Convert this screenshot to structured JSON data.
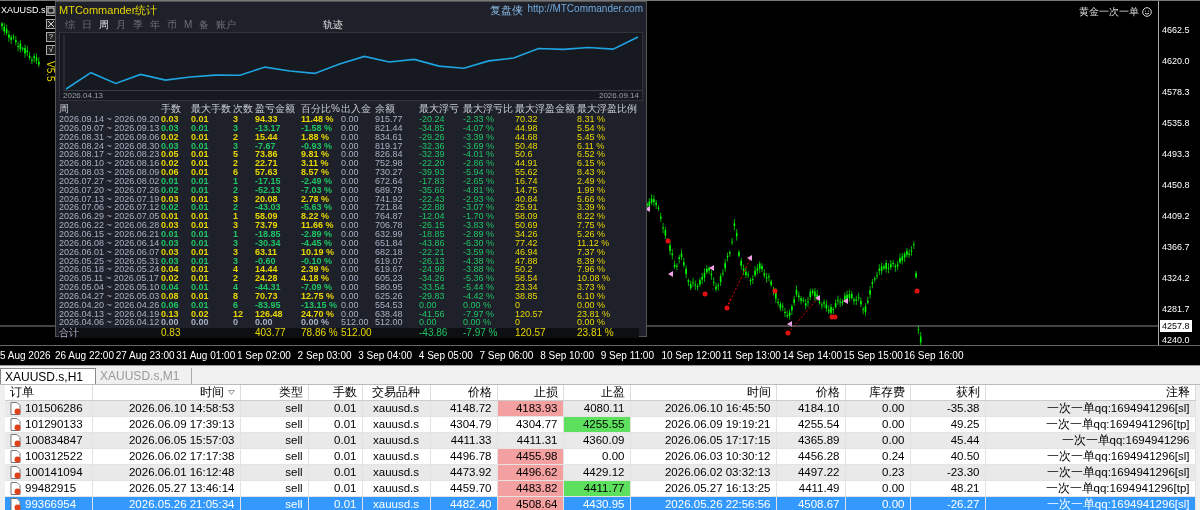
{
  "chart": {
    "symbol": "XAUUSD.s",
    "side_buttons": [
      {
        "kind": "window"
      },
      {
        "kind": "close"
      },
      {
        "kind": "text",
        "label": "?"
      },
      {
        "kind": "text",
        "label": "√"
      }
    ],
    "version": "V5.5",
    "corner_label": "黄金一次一单",
    "price_axis": [
      "4662.5",
      "4620.0",
      "4578.3",
      "4535.8",
      "4493.3",
      "4450.8",
      "4409.2",
      "4366.7",
      "4324.2",
      "4281.7",
      "4240.0"
    ],
    "current_price": "4257.8",
    "time_axis": [
      "5 Aug 2026",
      "26 Aug 22:00",
      "27 Aug 23:00",
      "31 Aug 01:00",
      "1 Sep 02:00",
      "2 Sep 03:00",
      "3 Sep 04:00",
      "4 Sep 05:00",
      "7 Sep 06:00",
      "8 Sep 10:00",
      "9 Sep 11:00",
      "10 Sep 12:00",
      "11 Sep 13:00",
      "14 Sep 14:00",
      "15 Sep 15:00",
      "16 Sep 16:00"
    ]
  },
  "stats_panel": {
    "title": "MTCommander统计",
    "brand": "复盘侠",
    "link": "http://MTCommander.com",
    "tabs": [
      {
        "label": "综",
        "selected": false
      },
      {
        "label": "日",
        "selected": false
      },
      {
        "label": "周",
        "selected": true
      },
      {
        "label": "月",
        "selected": false
      },
      {
        "label": "季",
        "selected": false
      },
      {
        "label": "年",
        "selected": false
      },
      {
        "label": "币",
        "selected": false
      },
      {
        "label": "M",
        "selected": false
      },
      {
        "label": "备",
        "selected": false
      },
      {
        "label": "账户",
        "selected": false
      }
    ],
    "trace_label": "轨迹",
    "curve_start": "2026.04.13",
    "curve_end": "2026.09.14",
    "columns": [
      "周",
      "手数",
      "最大手数",
      "次数",
      "盈亏金额",
      "百分比%",
      "出入金",
      "余额",
      "最大浮亏",
      "最大浮亏比",
      "最大浮盈金额",
      "最大浮盈比例"
    ],
    "rows": [
      {
        "week": "2026.09.14 ~ 2026.09.20",
        "color": "#e8d800",
        "values": [
          "0.03",
          "0.01",
          "3",
          "94.33",
          "11.48 %",
          "0.00",
          "915.77",
          "-20.24",
          "-2.33 %",
          "70.32",
          "8.31 %"
        ]
      },
      {
        "week": "2026.09.07 ~ 2026.09.13",
        "color": "#1ec466",
        "values": [
          "0.03",
          "0.01",
          "3",
          "-13.17",
          "-1.58 %",
          "0.00",
          "821.44",
          "-34.85",
          "-4.07 %",
          "44.98",
          "5.54 %"
        ]
      },
      {
        "week": "2026.08.31 ~ 2026.09.06",
        "color": "#e8d800",
        "values": [
          "0.02",
          "0.01",
          "2",
          "15.44",
          "1.88 %",
          "0.00",
          "834.61",
          "-29.26",
          "-3.39 %",
          "44.68",
          "5.45 %"
        ]
      },
      {
        "week": "2026.08.24 ~ 2026.08.30",
        "color": "#1ec466",
        "values": [
          "0.03",
          "0.01",
          "3",
          "-7.67",
          "-0.93 %",
          "0.00",
          "819.17",
          "-32.36",
          "-3.69 %",
          "50.48",
          "6.11 %"
        ]
      },
      {
        "week": "2026.08.17 ~ 2026.08.23",
        "color": "#e8d800",
        "values": [
          "0.05",
          "0.01",
          "5",
          "73.86",
          "9.81 %",
          "0.00",
          "826.84",
          "-32.39",
          "-4.01 %",
          "50.6",
          "6.52 %"
        ]
      },
      {
        "week": "2026.08.10 ~ 2026.08.16",
        "color": "#e8d800",
        "values": [
          "0.02",
          "0.01",
          "2",
          "22.71",
          "3.11 %",
          "0.00",
          "752.98",
          "-22.20",
          "-2.86 %",
          "44.91",
          "6.15 %"
        ]
      },
      {
        "week": "2026.08.03 ~ 2026.08.09",
        "color": "#e8d800",
        "values": [
          "0.06",
          "0.01",
          "6",
          "57.63",
          "8.57 %",
          "0.00",
          "730.27",
          "-39.93",
          "-5.94 %",
          "55.62",
          "8.43 %"
        ]
      },
      {
        "week": "2026.07.27 ~ 2026.08.02",
        "color": "#1ec466",
        "values": [
          "0.01",
          "0.01",
          "1",
          "-17.15",
          "-2.49 %",
          "0.00",
          "672.64",
          "-17.83",
          "-2.65 %",
          "16.74",
          "2.49 %"
        ]
      },
      {
        "week": "2026.07.20 ~ 2026.07.26",
        "color": "#1ec466",
        "values": [
          "0.02",
          "0.01",
          "2",
          "-52.13",
          "-7.03 %",
          "0.00",
          "689.79",
          "-35.66",
          "-4.81 %",
          "14.75",
          "1.99 %"
        ]
      },
      {
        "week": "2026.07.13 ~ 2026.07.19",
        "color": "#e8d800",
        "values": [
          "0.03",
          "0.01",
          "3",
          "20.08",
          "2.78 %",
          "0.00",
          "741.92",
          "-22.43",
          "-2.93 %",
          "40.84",
          "5.66 %"
        ]
      },
      {
        "week": "2026.07.06 ~ 2026.07.12",
        "color": "#1ec466",
        "values": [
          "0.02",
          "0.01",
          "2",
          "-43.03",
          "-5.63 %",
          "0.00",
          "721.84",
          "-22.88",
          "-3.07 %",
          "25.91",
          "3.39 %"
        ]
      },
      {
        "week": "2026.06.29 ~ 2026.07.05",
        "color": "#e8d800",
        "values": [
          "0.01",
          "0.01",
          "1",
          "58.09",
          "8.22 %",
          "0.00",
          "764.87",
          "-12.04",
          "-1.70 %",
          "58.09",
          "8.22 %"
        ]
      },
      {
        "week": "2026.06.22 ~ 2026.06.28",
        "color": "#e8d800",
        "values": [
          "0.03",
          "0.01",
          "3",
          "73.79",
          "11.66 %",
          "0.00",
          "706.78",
          "-26.15",
          "-3.83 %",
          "50.69",
          "7.75 %"
        ]
      },
      {
        "week": "2026.06.15 ~ 2026.06.21",
        "color": "#1ec466",
        "values": [
          "0.01",
          "0.01",
          "1",
          "-18.85",
          "-2.89 %",
          "0.00",
          "632.99",
          "-18.85",
          "-2.89 %",
          "34.26",
          "5.26 %"
        ]
      },
      {
        "week": "2026.06.08 ~ 2026.06.14",
        "color": "#1ec466",
        "values": [
          "0.03",
          "0.01",
          "3",
          "-30.34",
          "-4.45 %",
          "0.00",
          "651.84",
          "-43.86",
          "-6.30 %",
          "77.42",
          "11.12 %"
        ]
      },
      {
        "week": "2026.06.01 ~ 2026.06.07",
        "color": "#e8d800",
        "values": [
          "0.03",
          "0.01",
          "3",
          "63.11",
          "10.19 %",
          "0.00",
          "682.18",
          "-22.21",
          "-3.59 %",
          "46.94",
          "7.37 %"
        ]
      },
      {
        "week": "2026.05.25 ~ 2026.05.31",
        "color": "#1ec466",
        "values": [
          "0.03",
          "0.01",
          "3",
          "-0.60",
          "-0.10 %",
          "0.00",
          "619.07",
          "-26.13",
          "-4.38 %",
          "47.88",
          "8.39 %"
        ]
      },
      {
        "week": "2026.05.18 ~ 2026.05.24",
        "color": "#e8d800",
        "values": [
          "0.04",
          "0.01",
          "4",
          "14.44",
          "2.39 %",
          "0.00",
          "619.67",
          "-24.98",
          "-3.88 %",
          "50.2",
          "7.96 %"
        ]
      },
      {
        "week": "2026.05.11 ~ 2026.05.17",
        "color": "#e8d800",
        "values": [
          "0.02",
          "0.01",
          "2",
          "24.28",
          "4.18 %",
          "0.00",
          "605.23",
          "-34.26",
          "-5.36 %",
          "58.54",
          "10.08 %"
        ]
      },
      {
        "week": "2026.05.04 ~ 2026.05.10",
        "color": "#1ec466",
        "values": [
          "0.04",
          "0.01",
          "4",
          "-44.31",
          "-7.09 %",
          "0.00",
          "580.95",
          "-33.54",
          "-5.44 %",
          "23.34",
          "3.73 %"
        ]
      },
      {
        "week": "2026.04.27 ~ 2026.05.03",
        "color": "#e8d800",
        "values": [
          "0.08",
          "0.01",
          "8",
          "70.73",
          "12.75 %",
          "0.00",
          "625.26",
          "-29.83",
          "-4.42 %",
          "38.85",
          "6.10 %"
        ]
      },
      {
        "week": "2026.04.20 ~ 2026.04.26",
        "color": "#1ec466",
        "values": [
          "0.06",
          "0.01",
          "6",
          "-83.95",
          "-13.15 %",
          "0.00",
          "554.53",
          "0.00",
          "0.00 %",
          "0",
          "0.00 %"
        ]
      },
      {
        "week": "2026.04.13 ~ 2026.04.19",
        "color": "#e8d800",
        "values": [
          "0.13",
          "0.02",
          "12",
          "126.48",
          "24.70 %",
          "0.00",
          "638.48",
          "-41.56",
          "-7.97 %",
          "120.57",
          "23.81 %"
        ]
      },
      {
        "week": "2026.04.06 ~ 2026.04.12",
        "color": "#a8b0c4",
        "values": [
          "0.00",
          "0.00",
          "0",
          "0.00",
          "0.00 %",
          "512.00",
          "512.00",
          "0.00",
          "0.00 %",
          "0",
          "0.00 %"
        ]
      }
    ],
    "total": {
      "label": "合计",
      "lots": "0.83",
      "pnl": "403.77",
      "percent": "78.86 %",
      "deposit": "512.00",
      "max_float_loss": "-43.86",
      "max_float_loss_pct": "-7.97 %",
      "max_float_profit": "120.57",
      "max_float_profit_pct": "23.81 %"
    }
  },
  "chart_tabs": [
    {
      "label": "XAUUSD.s,H1",
      "selected": true
    },
    {
      "label": "XAUUSD.s,M1",
      "selected": false
    }
  ],
  "orders": {
    "columns": [
      {
        "label": "订单",
        "sorted": false
      },
      {
        "label": "时间",
        "sorted": true
      },
      {
        "label": "类型",
        "sorted": false
      },
      {
        "label": "手数",
        "sorted": false
      },
      {
        "label": "交易品种",
        "sorted": false
      },
      {
        "label": "价格",
        "sorted": false
      },
      {
        "label": "止损",
        "sorted": false
      },
      {
        "label": "止盈",
        "sorted": false
      },
      {
        "label": "时间",
        "sorted": false
      },
      {
        "label": "价格",
        "sorted": false
      },
      {
        "label": "库存费",
        "sorted": false
      },
      {
        "label": "获利",
        "sorted": false
      },
      {
        "label": "注释",
        "sorted": false
      }
    ],
    "rows": [
      {
        "cells": [
          "101506286",
          "2026.06.10 14:58:53",
          "sell",
          "0.01",
          "xauusd.s",
          "4148.72",
          "4183.93",
          "4080.11",
          "2026.06.10 16:45:50",
          "4184.10",
          "0.00",
          "-35.38",
          "一次一单qq:1694941296[sl]"
        ],
        "sl_highlight": true,
        "tp_highlight": false,
        "selected": false
      },
      {
        "cells": [
          "101290133",
          "2026.06.09 17:39:13",
          "sell",
          "0.01",
          "xauusd.s",
          "4304.79",
          "4304.77",
          "4255.55",
          "2026.06.09 19:19:21",
          "4255.54",
          "0.00",
          "49.25",
          "一次一单qq:1694941296[tp]"
        ],
        "sl_highlight": false,
        "tp_highlight": true,
        "selected": false
      },
      {
        "cells": [
          "100834847",
          "2026.06.05 15:57:03",
          "sell",
          "0.01",
          "xauusd.s",
          "4411.33",
          "4411.31",
          "4360.09",
          "2026.06.05 17:17:15",
          "4365.89",
          "0.00",
          "45.44",
          "一次一单qq:1694941296"
        ],
        "sl_highlight": false,
        "tp_highlight": false,
        "selected": false
      },
      {
        "cells": [
          "100312522",
          "2026.06.02 17:17:38",
          "sell",
          "0.01",
          "xauusd.s",
          "4496.78",
          "4455.98",
          "0.00",
          "2026.06.03 10:30:12",
          "4456.28",
          "0.24",
          "40.50",
          "一次一单qq:1694941296[sl]"
        ],
        "sl_highlight": true,
        "tp_highlight": false,
        "selected": false
      },
      {
        "cells": [
          "100141094",
          "2026.06.01 16:12:48",
          "sell",
          "0.01",
          "xauusd.s",
          "4473.92",
          "4496.62",
          "4429.12",
          "2026.06.02 03:32:13",
          "4497.22",
          "0.23",
          "-23.30",
          "一次一单qq:1694941296[sl]"
        ],
        "sl_highlight": true,
        "tp_highlight": false,
        "selected": false
      },
      {
        "cells": [
          "99482915",
          "2026.05.27 13:46:14",
          "sell",
          "0.01",
          "xauusd.s",
          "4459.70",
          "4483.82",
          "4411.77",
          "2026.05.27 16:13:25",
          "4411.49",
          "0.00",
          "48.21",
          "一次一单qq:1694941296[tp]"
        ],
        "sl_highlight": true,
        "tp_highlight": true,
        "selected": false
      },
      {
        "cells": [
          "99366954",
          "2026.05.26 21:05:34",
          "sell",
          "0.01",
          "xauusd.s",
          "4482.40",
          "4508.64",
          "4430.95",
          "2026.05.26 22:56:56",
          "4508.67",
          "0.00",
          "-26.27",
          "一次一单qq:1694941296[sl]"
        ],
        "sl_highlight": true,
        "tp_highlight": false,
        "selected": true
      }
    ]
  }
}
